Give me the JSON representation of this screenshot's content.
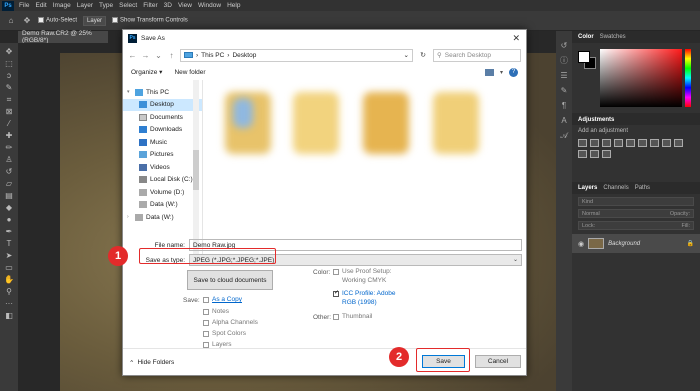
{
  "ps": {
    "logo": "Ps",
    "menu": [
      "File",
      "Edit",
      "Image",
      "Layer",
      "Type",
      "Select",
      "Filter",
      "3D",
      "View",
      "Window",
      "Help"
    ],
    "options": {
      "auto_select": "Auto-Select",
      "layer_select": "Layer",
      "show_transform": "Show Transform Controls"
    },
    "doc_tab": "Demo Raw.CR2 @ 25% (RGB/8*)"
  },
  "panels": {
    "color_tabs": [
      "Color",
      "Swatches"
    ],
    "adjustments_title": "Adjustments",
    "adjustments_sub": "Add an adjustment",
    "layers_tabs": [
      "Layers",
      "Channels",
      "Paths"
    ],
    "kind": "Kind",
    "blend": "Normal",
    "opacity": "Opacity:",
    "lock": "Lock:",
    "fill": "Fill:",
    "layer_name": "Background"
  },
  "dialog": {
    "title": "Save As",
    "breadcrumb": [
      "This PC",
      "Desktop"
    ],
    "search_placeholder": "Search Desktop",
    "organize": "Organize ▾",
    "new_folder": "New folder",
    "nav": [
      {
        "label": "This PC",
        "level": 0,
        "icon": "pc"
      },
      {
        "label": "Desktop",
        "level": 1,
        "icon": "folder-blue",
        "selected": true
      },
      {
        "label": "Documents",
        "level": 1,
        "icon": "docs"
      },
      {
        "label": "Downloads",
        "level": 1,
        "icon": "down"
      },
      {
        "label": "Music",
        "level": 1,
        "icon": "music"
      },
      {
        "label": "Pictures",
        "level": 1,
        "icon": "pics"
      },
      {
        "label": "Videos",
        "level": 1,
        "icon": "video"
      },
      {
        "label": "Local Disk (C:)",
        "level": 1,
        "icon": "drive"
      },
      {
        "label": "Volume (D:)",
        "level": 1,
        "icon": "drive2"
      },
      {
        "label": "Data (W:)",
        "level": 1,
        "icon": "drive2"
      },
      {
        "label": "Data (W:)",
        "level": 0,
        "icon": "drive2"
      }
    ],
    "file_name_label": "File name:",
    "file_name_value": "Demo Raw.jpg",
    "save_type_label": "Save as type:",
    "save_type_value": "JPEG (*.JPG;*.JPEG;*.JPE)",
    "cloud_button": "Save to cloud documents",
    "save_label": "Save:",
    "as_copy": "As a Copy",
    "notes": "Notes",
    "alpha": "Alpha Channels",
    "spot": "Spot Colors",
    "layers": "Layers",
    "color_label": "Color:",
    "proof_setup_1": "Use Proof Setup:",
    "proof_setup_2": "Working CMYK",
    "icc_1": "ICC Profile:  Adobe",
    "icc_2": "RGB (1998)",
    "other_label": "Other:",
    "thumbnail": "Thumbnail",
    "hide_folders": "Hide Folders",
    "save_button": "Save",
    "cancel_button": "Cancel"
  },
  "annotations": {
    "badge1": "1",
    "badge2": "2"
  },
  "colors": {
    "highlight": "#e32b2b",
    "accent": "#0078d7"
  }
}
